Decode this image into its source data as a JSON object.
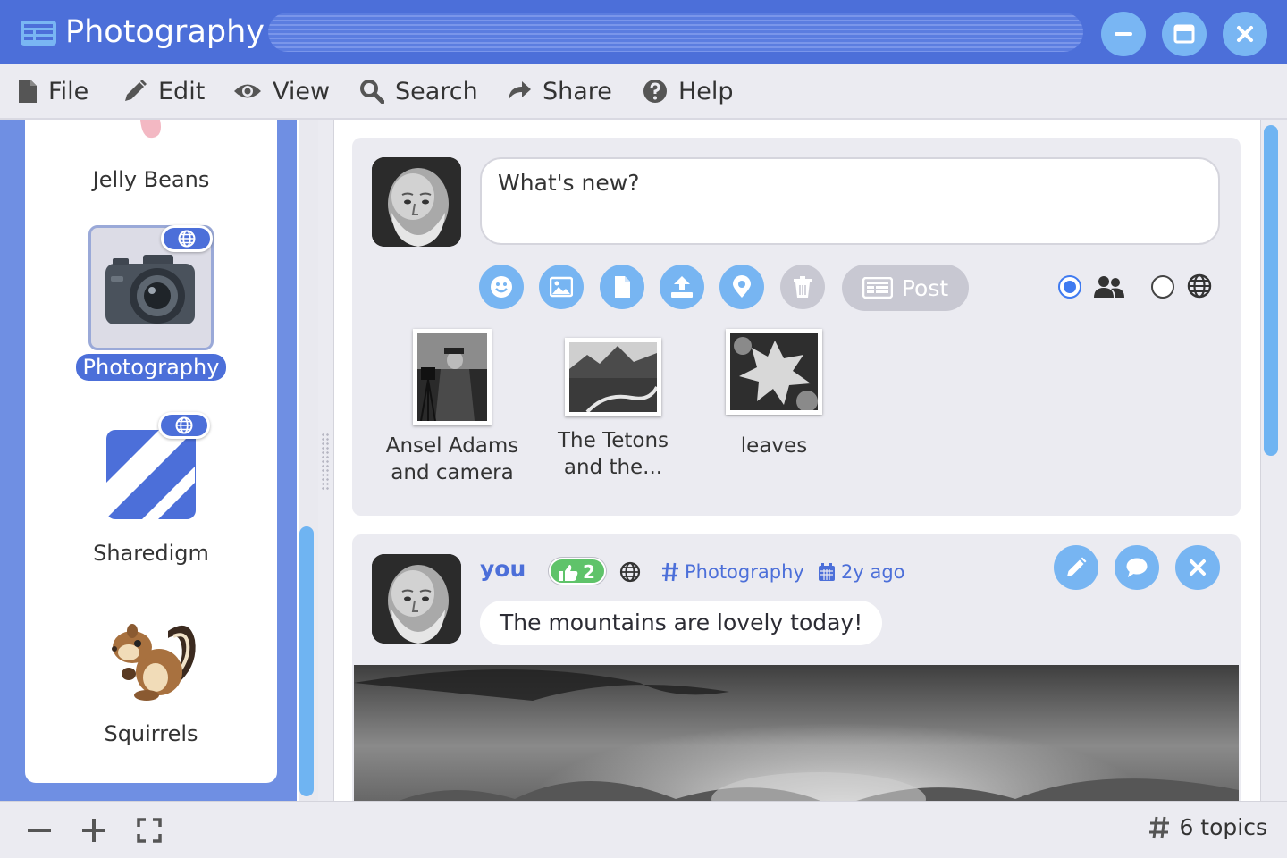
{
  "window": {
    "title": "Photography",
    "minimize_icon": "minus-icon",
    "maximize_icon": "window-icon",
    "close_icon": "close-icon"
  },
  "menu": [
    {
      "label": "File",
      "icon": "file-icon"
    },
    {
      "label": "Edit",
      "icon": "pencil-icon"
    },
    {
      "label": "View",
      "icon": "eye-icon"
    },
    {
      "label": "Search",
      "icon": "search-icon"
    },
    {
      "label": "Share",
      "icon": "share-icon"
    },
    {
      "label": "Help",
      "icon": "help-icon"
    }
  ],
  "sidebar": {
    "topics": [
      {
        "label": "Jelly Beans",
        "icon": "jelly-bean-icon",
        "selected": false,
        "public": false
      },
      {
        "label": "Photography",
        "icon": "camera-icon",
        "selected": true,
        "public": true
      },
      {
        "label": "Sharedigm",
        "icon": "sharedigm-logo-icon",
        "selected": false,
        "public": true
      },
      {
        "label": "Squirrels",
        "icon": "chipmunk-icon",
        "selected": false,
        "public": false
      }
    ]
  },
  "composer": {
    "placeholder": "What's new?",
    "tools": [
      "emoji-icon",
      "image-icon",
      "file-icon",
      "upload-icon",
      "location-icon",
      "trash-icon"
    ],
    "post_label": "Post",
    "audience": {
      "selected": "friends",
      "options": [
        "friends-icon",
        "globe-icon"
      ]
    },
    "attachments": [
      {
        "label": "Ansel Adams and camera"
      },
      {
        "label": "The Tetons and the..."
      },
      {
        "label": "leaves"
      }
    ]
  },
  "post": {
    "author": "you",
    "likes": "2",
    "topic": "Photography",
    "time": "2y ago",
    "message": "The mountains are lovely today!",
    "actions": [
      "edit-icon",
      "comment-icon",
      "delete-icon"
    ]
  },
  "status": {
    "topic_count": "6 topics"
  },
  "colors": {
    "accent": "#4c6fd9",
    "button": "#77b5f2",
    "like": "#5fc36a",
    "panel": "#ebebf1"
  }
}
